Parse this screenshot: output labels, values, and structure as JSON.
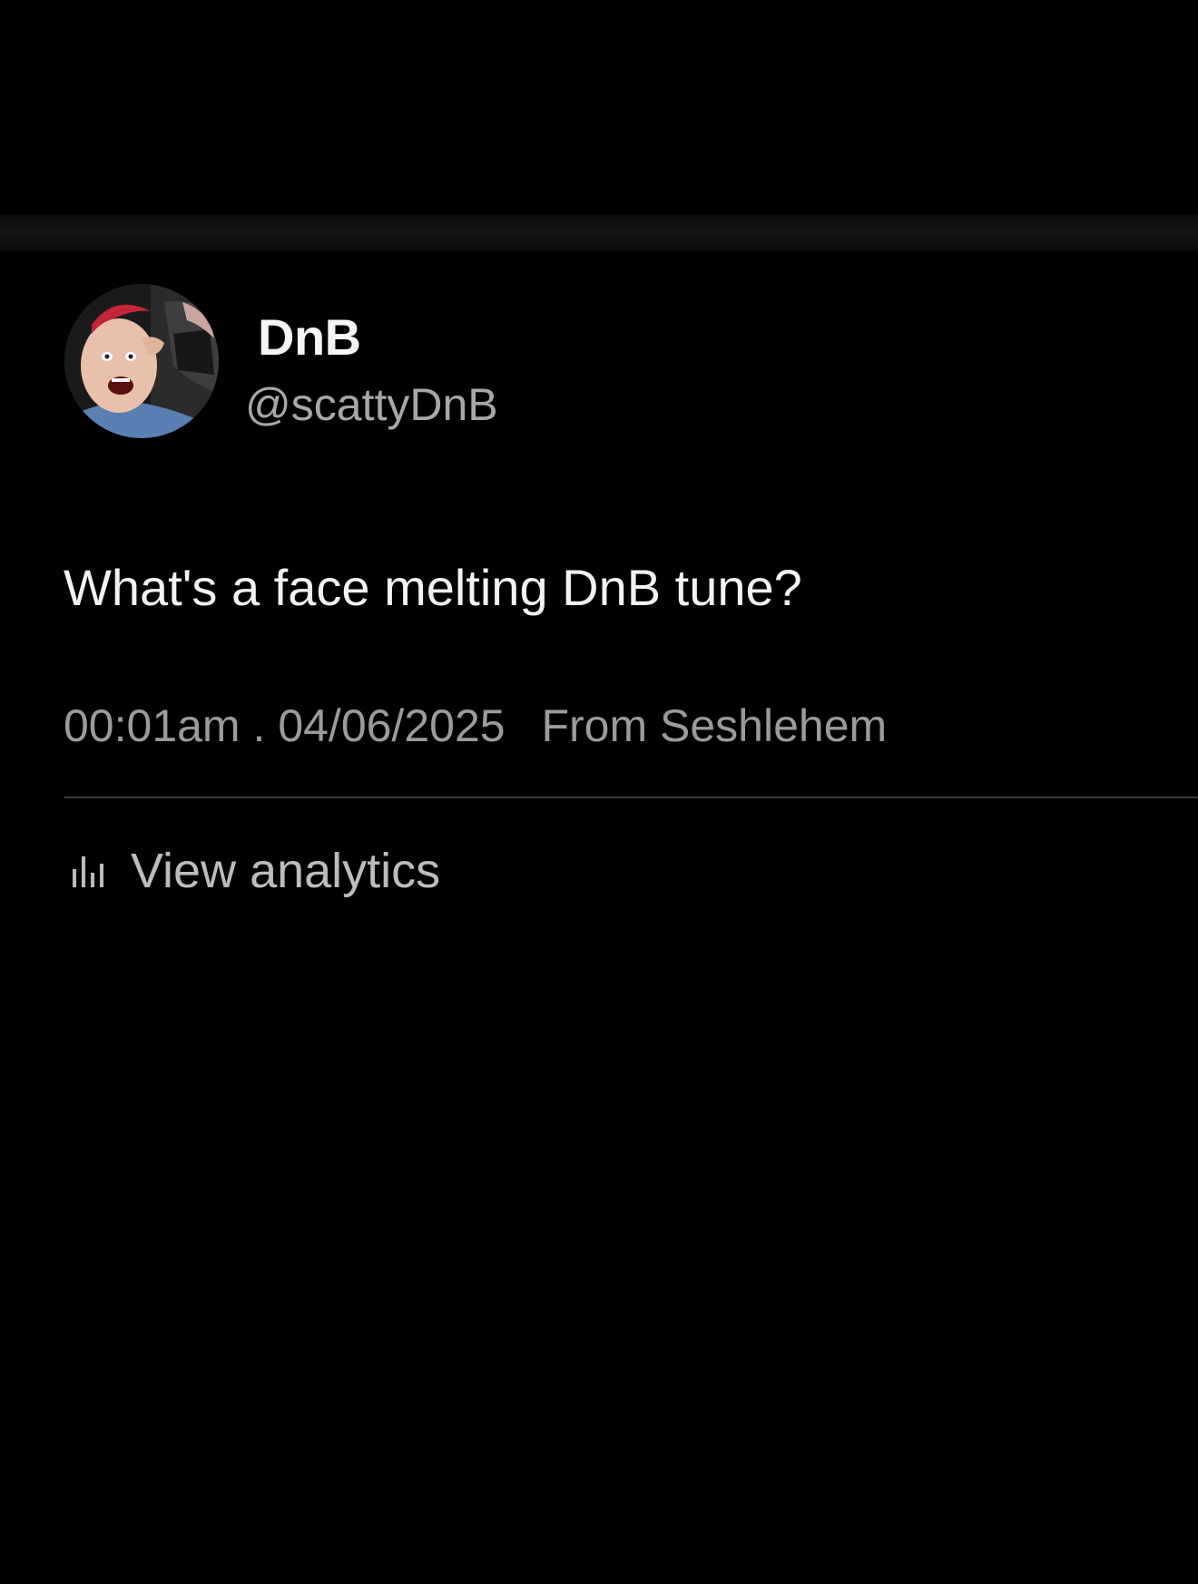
{
  "post": {
    "author": {
      "display_name": "DnB",
      "handle": "@scattyDnB",
      "avatar_icon": "profile-photo"
    },
    "text": "What's a face melting DnB tune?",
    "meta": {
      "time": "00:01am",
      "separator": ".",
      "date": "04/06/2025",
      "source": "From Seshlehem"
    },
    "analytics": {
      "icon": "bar-chart-icon",
      "label": "View analytics"
    }
  },
  "colors": {
    "background": "#000000",
    "primary_text": "#f2f2f2",
    "secondary_text": "#9b9b9b",
    "divider": "#3a3a3a"
  }
}
